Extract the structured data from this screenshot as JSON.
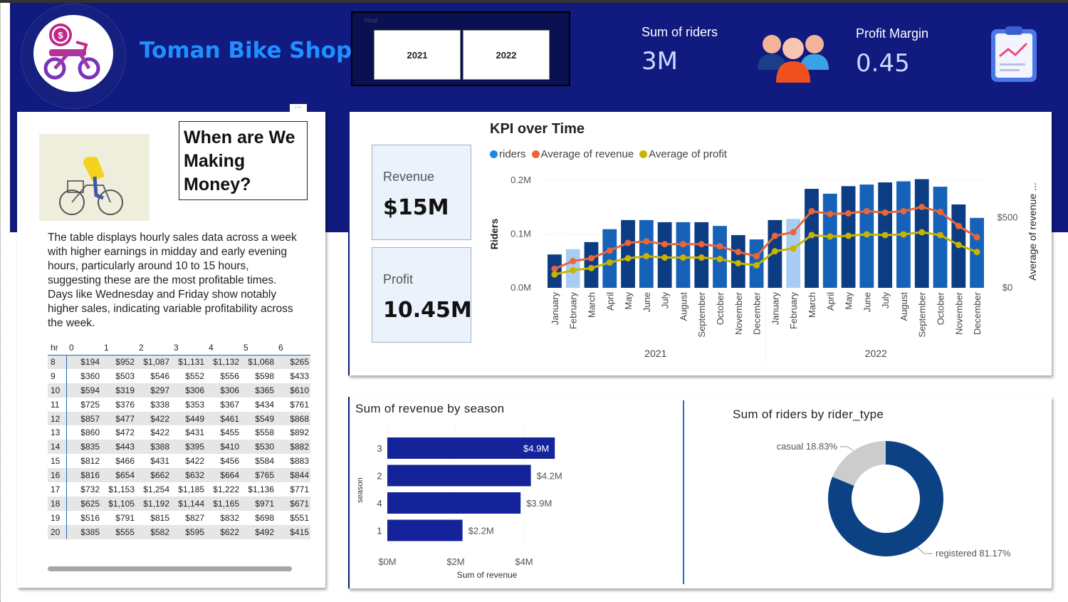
{
  "header": {
    "title": "Toman Bike Shop",
    "year_slicer": {
      "title": "Year",
      "options": [
        "2021",
        "2022"
      ]
    },
    "kpis": [
      {
        "label": "Sum of riders",
        "value": "3M",
        "icon": "people-icon"
      },
      {
        "label": "Profit Margin",
        "value": "0.45",
        "icon": "clipboard-chart-icon"
      }
    ]
  },
  "story": {
    "title": "When are We Making Money?",
    "text": "The table displays hourly sales data across a week with higher earnings in midday and early evening hours, particularly around 10 to 15 hours, suggesting these are the most profitable times. Days like Wednesday and Friday show notably higher sales, indicating variable profitability across the week.",
    "table": {
      "columns": [
        "hr",
        "0",
        "1",
        "2",
        "3",
        "4",
        "5",
        "6"
      ],
      "rows": [
        [
          "8",
          "$194",
          "$952",
          "$1,087",
          "$1,131",
          "$1,132",
          "$1,068",
          "$265"
        ],
        [
          "9",
          "$360",
          "$503",
          "$546",
          "$552",
          "$556",
          "$598",
          "$433"
        ],
        [
          "10",
          "$594",
          "$319",
          "$297",
          "$306",
          "$306",
          "$365",
          "$610"
        ],
        [
          "11",
          "$725",
          "$376",
          "$338",
          "$353",
          "$367",
          "$434",
          "$761"
        ],
        [
          "12",
          "$857",
          "$477",
          "$422",
          "$449",
          "$461",
          "$549",
          "$868"
        ],
        [
          "13",
          "$860",
          "$472",
          "$422",
          "$431",
          "$455",
          "$558",
          "$892"
        ],
        [
          "14",
          "$835",
          "$443",
          "$388",
          "$395",
          "$410",
          "$530",
          "$882"
        ],
        [
          "15",
          "$812",
          "$466",
          "$431",
          "$422",
          "$456",
          "$584",
          "$883"
        ],
        [
          "16",
          "$816",
          "$654",
          "$662",
          "$632",
          "$664",
          "$765",
          "$844"
        ],
        [
          "17",
          "$732",
          "$1,153",
          "$1,254",
          "$1,185",
          "$1,222",
          "$1,136",
          "$771"
        ],
        [
          "18",
          "$625",
          "$1,105",
          "$1,192",
          "$1,144",
          "$1,165",
          "$971",
          "$671"
        ],
        [
          "19",
          "$516",
          "$791",
          "$815",
          "$827",
          "$832",
          "$698",
          "$551"
        ],
        [
          "20",
          "$385",
          "$555",
          "$582",
          "$595",
          "$622",
          "$492",
          "$415"
        ]
      ]
    }
  },
  "cards": {
    "revenue": {
      "label": "Revenue",
      "value": "$15M"
    },
    "profit": {
      "label": "Profit",
      "value": "10.45M"
    }
  },
  "colors": {
    "banner": "#111a7e",
    "bar_dark": "#0c3c82",
    "bar_mid": "#1662b8",
    "bar_light": "#a8cdf5",
    "revenue_line": "#e8663a",
    "profit_line": "#c8b400",
    "season_bar": "#14239a",
    "donut_registered": "#0c4283",
    "donut_casual": "#cccccc"
  },
  "chart_data": [
    {
      "type": "bar",
      "title": "KPI over Time",
      "legend": [
        "riders",
        "Average of revenue",
        "Average of profit"
      ],
      "legend_colors": [
        "#1e88e5",
        "#e8663a",
        "#c8b400"
      ],
      "ylabel": "Riders",
      "y2label": "Average of revenue ...",
      "y_ticks": [
        "0.0M",
        "0.1M",
        "0.2M"
      ],
      "y2_ticks": [
        "$0",
        "$500"
      ],
      "ylim": [
        0,
        200000
      ],
      "y2lim": [
        0,
        765
      ],
      "years": [
        "2021",
        "2022"
      ],
      "categories": [
        "January",
        "February",
        "March",
        "April",
        "May",
        "June",
        "July",
        "August",
        "September",
        "October",
        "November",
        "December",
        "January",
        "February",
        "March",
        "April",
        "May",
        "June",
        "July",
        "August",
        "September",
        "October",
        "November",
        "December"
      ],
      "series": [
        {
          "name": "riders",
          "values": [
            62000,
            72000,
            85000,
            109000,
            126000,
            126000,
            122000,
            122000,
            122000,
            115000,
            98000,
            90000,
            126000,
            128000,
            184000,
            175000,
            189000,
            192000,
            196000,
            198000,
            202000,
            188000,
            155000,
            130000
          ]
        },
        {
          "name": "Average of revenue",
          "values": [
            135,
            190,
            210,
            265,
            320,
            330,
            310,
            310,
            310,
            295,
            255,
            225,
            370,
            395,
            545,
            525,
            530,
            545,
            535,
            545,
            575,
            540,
            440,
            360
          ]
        },
        {
          "name": "Average of profit",
          "values": [
            95,
            125,
            140,
            180,
            210,
            225,
            215,
            215,
            215,
            205,
            175,
            160,
            260,
            280,
            375,
            365,
            370,
            380,
            375,
            380,
            395,
            375,
            305,
            255
          ]
        }
      ]
    },
    {
      "type": "bar",
      "title": "Sum of revenue by season",
      "orientation": "horizontal",
      "xlabel": "Sum of revenue",
      "ylabel": "season",
      "x_ticks": [
        "$0M",
        "$2M",
        "$4M"
      ],
      "xlim": [
        0,
        5000000
      ],
      "categories": [
        "3",
        "2",
        "4",
        "1"
      ],
      "values": [
        4900000,
        4200000,
        3900000,
        2200000
      ],
      "labels": [
        "$4.9M",
        "$4.2M",
        "$3.9M",
        "$2.2M"
      ]
    },
    {
      "type": "pie",
      "title": "Sum of riders by rider_type",
      "categories": [
        "casual",
        "registered"
      ],
      "values": [
        18.83,
        81.17
      ],
      "labels": [
        "casual 18.83%",
        "registered 81.17%"
      ]
    }
  ]
}
